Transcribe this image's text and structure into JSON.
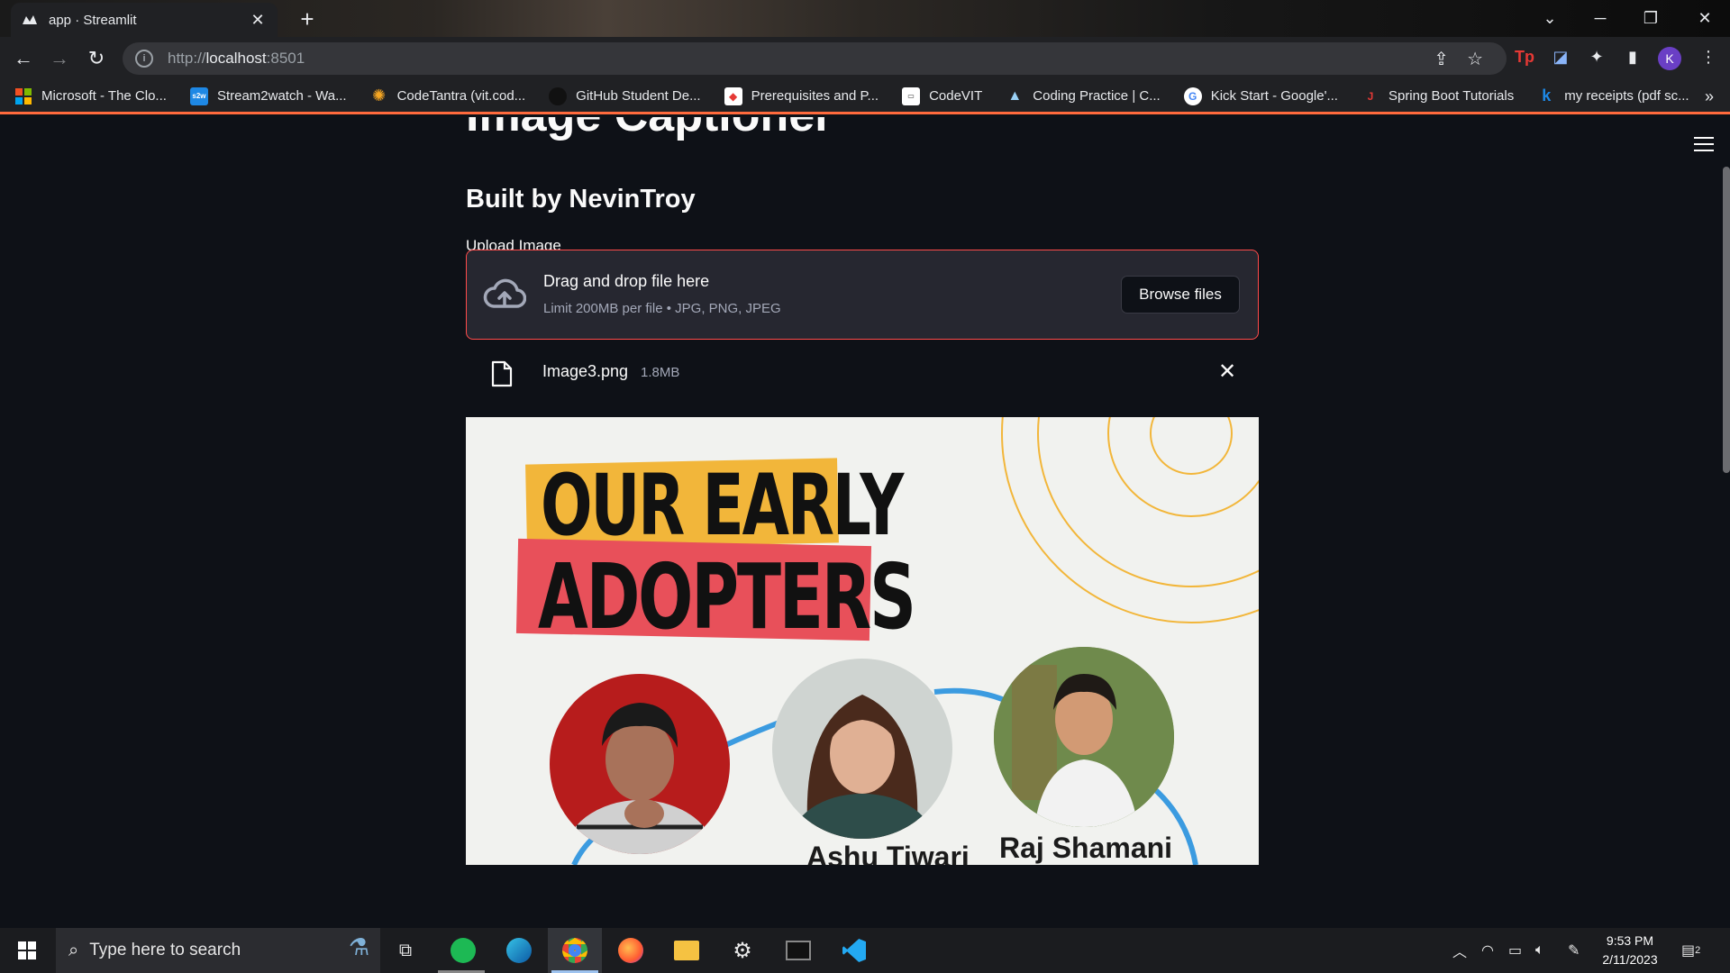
{
  "browser": {
    "tab_title": "app · Streamlit",
    "url_prefix": "http://",
    "url_host": "localhost",
    "url_port": ":8501"
  },
  "bookmarks": [
    {
      "label": "Microsoft - The Clo...",
      "icon": "microsoft-logo"
    },
    {
      "label": "Stream2watch - Wa...",
      "icon": "s2w-logo"
    },
    {
      "label": "CodeTantra (vit.cod...",
      "icon": "sun-logo"
    },
    {
      "label": "GitHub Student De...",
      "icon": "github-logo"
    },
    {
      "label": "Prerequisites and P...",
      "icon": "prereq-logo"
    },
    {
      "label": "CodeVIT",
      "icon": "codevit-logo"
    },
    {
      "label": "Coding Practice | C...",
      "icon": "mountain-logo"
    },
    {
      "label": "Kick Start - Google'...",
      "icon": "google-logo"
    },
    {
      "label": "Spring Boot Tutorials",
      "icon": "j-logo"
    },
    {
      "label": "my receipts (pdf sc...",
      "icon": "k-logo"
    }
  ],
  "app": {
    "title": "Image Captioner",
    "subtitle": "Built by NevinTroy",
    "uploader_label": "Upload Image",
    "dropzone_title": "Drag and drop file here",
    "dropzone_limits": "Limit 200MB per file • JPG, PNG, JPEG",
    "browse_label": "Browse files",
    "file_name": "Image3.png",
    "file_size": "1.8MB"
  },
  "poster": {
    "line1": "OUR EARLY",
    "line2": "ADOPTERS",
    "name_middle": "Ashu Tiwari",
    "name_right": "Raj Shamani"
  },
  "taskbar": {
    "search_placeholder": "Type here to search",
    "time": "9:53 PM",
    "date": "2/11/2023",
    "notifications": "2"
  },
  "colors": {
    "streamlit_bg": "#0e1117",
    "accent_red": "#ff4b4b",
    "secondary_bg": "#262730"
  }
}
